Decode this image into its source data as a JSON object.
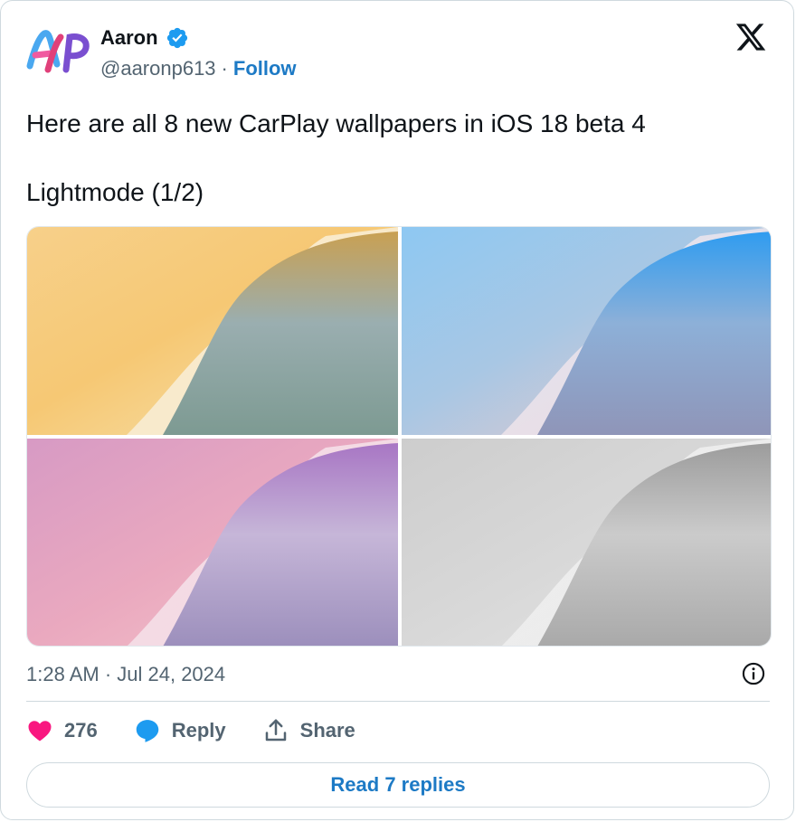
{
  "author": {
    "name": "Aaron",
    "handle": "@aaronp613",
    "separator": "·",
    "follow_label": "Follow",
    "verified": true
  },
  "tweet": {
    "line1": "Here are all 8 new CarPlay wallpapers in iOS 18 beta 4",
    "line2": "Lightmode (1/2)"
  },
  "media": {
    "images": [
      {
        "name": "wallpaper-orange-teal"
      },
      {
        "name": "wallpaper-blue"
      },
      {
        "name": "wallpaper-pink-purple"
      },
      {
        "name": "wallpaper-gray"
      }
    ]
  },
  "meta": {
    "timestamp": "1:28 AM · Jul 24, 2024"
  },
  "actions": {
    "like_count": "276",
    "reply_label": "Reply",
    "share_label": "Share"
  },
  "footer": {
    "read_replies_label": "Read 7 replies"
  },
  "colors": {
    "link": "#1d7ac5",
    "like": "#f91880",
    "reply": "#1d9bf0",
    "verified": "#1d9bf0"
  }
}
